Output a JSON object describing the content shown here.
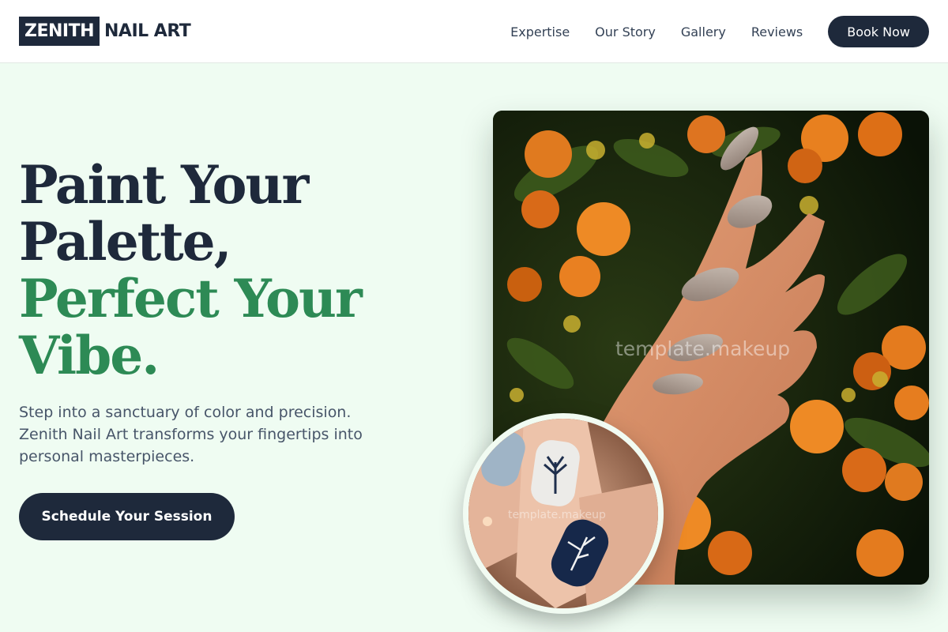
{
  "brand": {
    "logo_box": "ZENITH",
    "logo_rest": "NAIL ART"
  },
  "nav": {
    "links": [
      "Expertise",
      "Our Story",
      "Gallery",
      "Reviews"
    ],
    "cta": "Book Now"
  },
  "hero": {
    "headline_dark": [
      "Paint Your",
      "Palette,"
    ],
    "headline_green": [
      "Perfect Your",
      "Vibe."
    ],
    "subtext": "Step into a sanctuary of color and precision. Zenith Nail Art transforms your fingertips into personal masterpieces.",
    "cta": "Schedule Your Session"
  },
  "images": {
    "main_watermark": "template.makeup",
    "circle_watermark": "template.makeup"
  },
  "colors": {
    "dark": "#1e293b",
    "green": "#2d8a55",
    "background": "#effcf2"
  }
}
